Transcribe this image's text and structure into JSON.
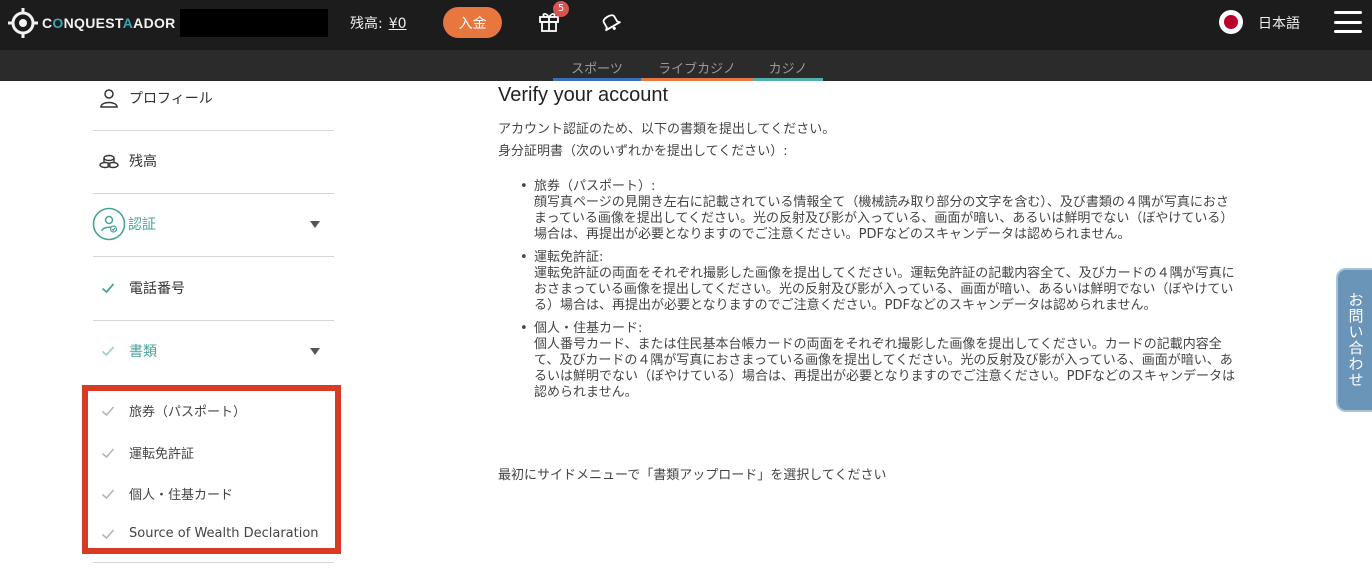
{
  "header": {
    "brand": {
      "part1": "C",
      "part2": "NQUEST",
      "part3": "ADOR"
    },
    "balance_label": "残高:",
    "balance_value": "¥0",
    "deposit_label": "入金",
    "gift_badge": "5",
    "language": "日本語",
    "colors": {
      "bar": "#1c1c1c",
      "deposit": "#e8773f",
      "brand_accent": "#3aa3b6"
    }
  },
  "subnav": {
    "tabs": [
      {
        "label": "スポーツ",
        "color": "#3b6fb5"
      },
      {
        "label": "ライブカジノ",
        "color": "#e8773f"
      },
      {
        "label": "カジノ",
        "color": "#4fb0a8"
      }
    ]
  },
  "sidebar": {
    "profile": "プロフィール",
    "balance": "残高",
    "verification": "認証",
    "phone": "電話番号",
    "documents": "書類",
    "document_items": [
      "旅券（パスポート）",
      "運転免許証",
      "個人・住基カード",
      "Source of Wealth Declaration"
    ],
    "accent_color": "#4aa39a"
  },
  "main": {
    "title": "Verify your account",
    "intro": "アカウント認証のため、以下の書類を提出してください。",
    "id_heading": "身分証明書（次のいずれかを提出してください）:",
    "requirements": [
      {
        "title": "旅券（パスポート）:",
        "lines": [
          "顔写真ページの見開き左右に記載されている情報全て（機械読み取り部分の文字を含む）、及び書類の４隅が写真におさ",
          "まっている画像を提出してください。光の反射及び影が入っている、画面が暗い、あるいは鮮明でない（ぼやけている）",
          "場合は、再提出が必要となりますのでご注意ください。PDFなどのスキャンデータは認められません。"
        ]
      },
      {
        "title": "運転免許証:",
        "lines": [
          "運転免許証の両面をそれぞれ撮影した画像を提出してください。運転免許証の記載内容全て、及びカードの４隅が写真に",
          "おさまっている画像を提出してください。光の反射及び影が入っている、画面が暗い、あるいは鮮明でない（ぼやけてい",
          "る）場合は、再提出が必要となりますのでご注意ください。PDFなどのスキャンデータは認められません。"
        ]
      },
      {
        "title": "個人・住基カード:",
        "lines": [
          "個人番号カード、または住民基本台帳カードの両面をそれぞれ撮影した画像を提出してください。カードの記載内容全",
          "て、及びカードの４隅が写真におさまっている画像を提出してください。光の反射及び影が入っている、画面が暗い、あ",
          "るいは鮮明でない（ぼやけている）場合は、再提出が必要となりますのでご注意ください。PDFなどのスキャンデータは",
          "認められません。"
        ]
      }
    ],
    "footer_note": "最初にサイドメニューで「書類アップロード」を選択してください"
  },
  "contact_tab": "お問い合わせ"
}
